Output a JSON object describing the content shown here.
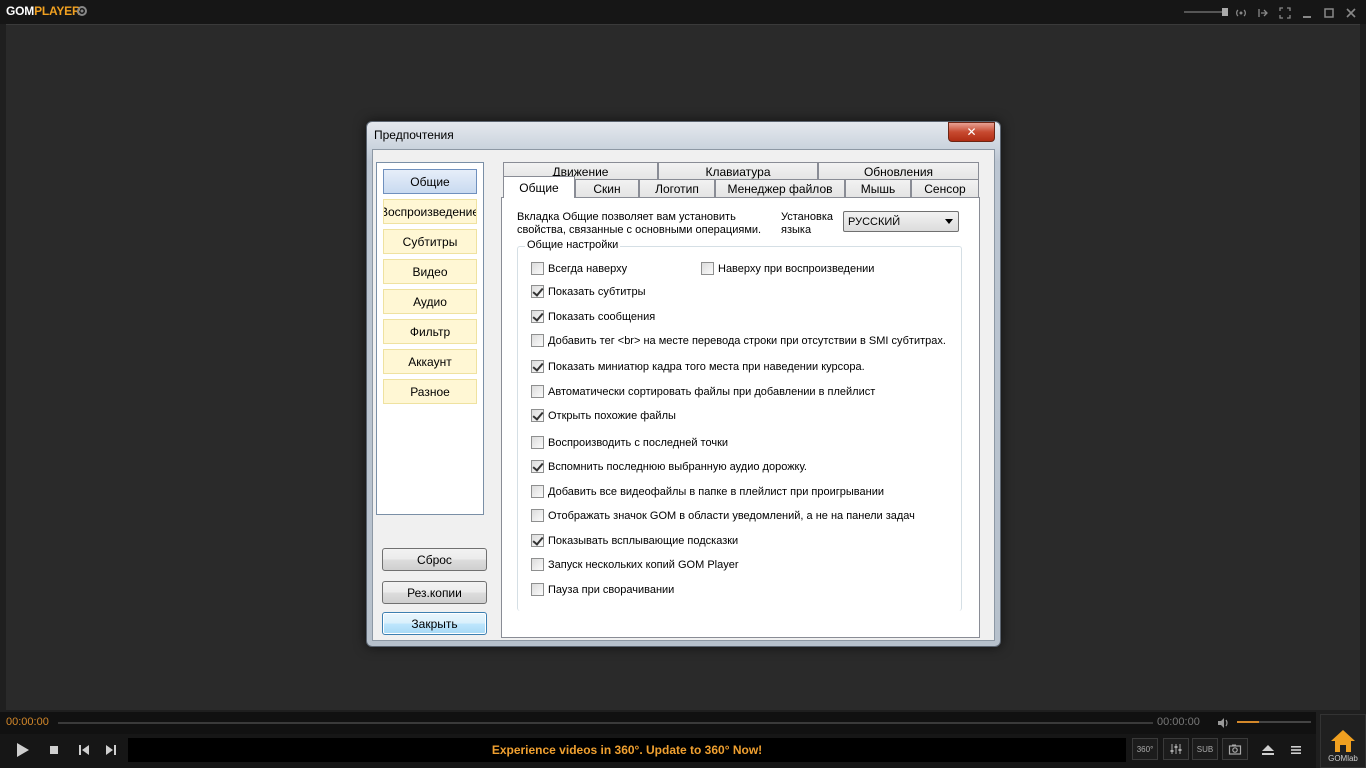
{
  "app": {
    "logo_main": "GOM",
    "logo_accent": "PLAYER"
  },
  "player": {
    "time_current": "00:00:00",
    "time_total": "00:00:00",
    "volume_level": 0.3,
    "banner_text": "Experience videos in 360°. Update to 360° Now!",
    "btn_sub_label": "SUB",
    "btn_360_label": "360°",
    "gomlab_label": "GOMlab"
  },
  "dialog": {
    "title": "Предпочтения",
    "close_label": "✕",
    "sidebar": {
      "items": [
        {
          "label": "Общие",
          "active": true
        },
        {
          "label": "Воспроизведение",
          "active": false
        },
        {
          "label": "Субтитры",
          "active": false
        },
        {
          "label": "Видео",
          "active": false
        },
        {
          "label": "Аудио",
          "active": false
        },
        {
          "label": "Фильтр",
          "active": false
        },
        {
          "label": "Аккаунт",
          "active": false
        },
        {
          "label": "Разное",
          "active": false
        }
      ],
      "reset_label": "Сброс",
      "backup_label": "Рез.копии",
      "close_label": "Закрыть"
    },
    "tabs_row1": [
      "Движение",
      "Клавиатура",
      "Обновления"
    ],
    "tabs_row2": [
      "Общие",
      "Скин",
      "Логотип",
      "Менеджер файлов",
      "Мышь",
      "Сенсор"
    ],
    "active_tab": "Общие",
    "panel": {
      "description": "Вкладка Общие позволяет вам установить свойства, связанные с основными операциями.",
      "language_label": "Установка языка",
      "language_value": "РУССКИЙ",
      "group_title": "Общие настройки",
      "options": [
        {
          "label": "Всегда наверху",
          "checked": false
        },
        {
          "label": "Наверху при воспроизведении",
          "checked": false
        },
        {
          "label": "Показать субтитры",
          "checked": true
        },
        {
          "label": "Показать сообщения",
          "checked": true
        },
        {
          "label": "Добавить тег <br> на месте перевода строки при отсутствии в SMI субтитрах.",
          "checked": false
        },
        {
          "label": "Показать миниатюр кадра того места при наведении курсора.",
          "checked": true
        },
        {
          "label": "Автоматически сортировать файлы при добавлении в плейлист",
          "checked": false
        },
        {
          "label": "Открыть похожие файлы",
          "checked": true
        },
        {
          "label": "Воспроизводить с последней точки",
          "checked": false
        },
        {
          "label": "Вспомнить последнюю выбранную аудио дорожку.",
          "checked": true
        },
        {
          "label": "Добавить все видеофайлы в папке в плейлист при проигрывании",
          "checked": false
        },
        {
          "label": "Отображать значок GOM в области уведомлений, а не на панели задач",
          "checked": false
        },
        {
          "label": "Показывать всплывающие подсказки",
          "checked": true
        },
        {
          "label": "Запуск нескольких копий GOM Player",
          "checked": false
        },
        {
          "label": "Пауза при сворачивании",
          "checked": false
        }
      ]
    }
  }
}
